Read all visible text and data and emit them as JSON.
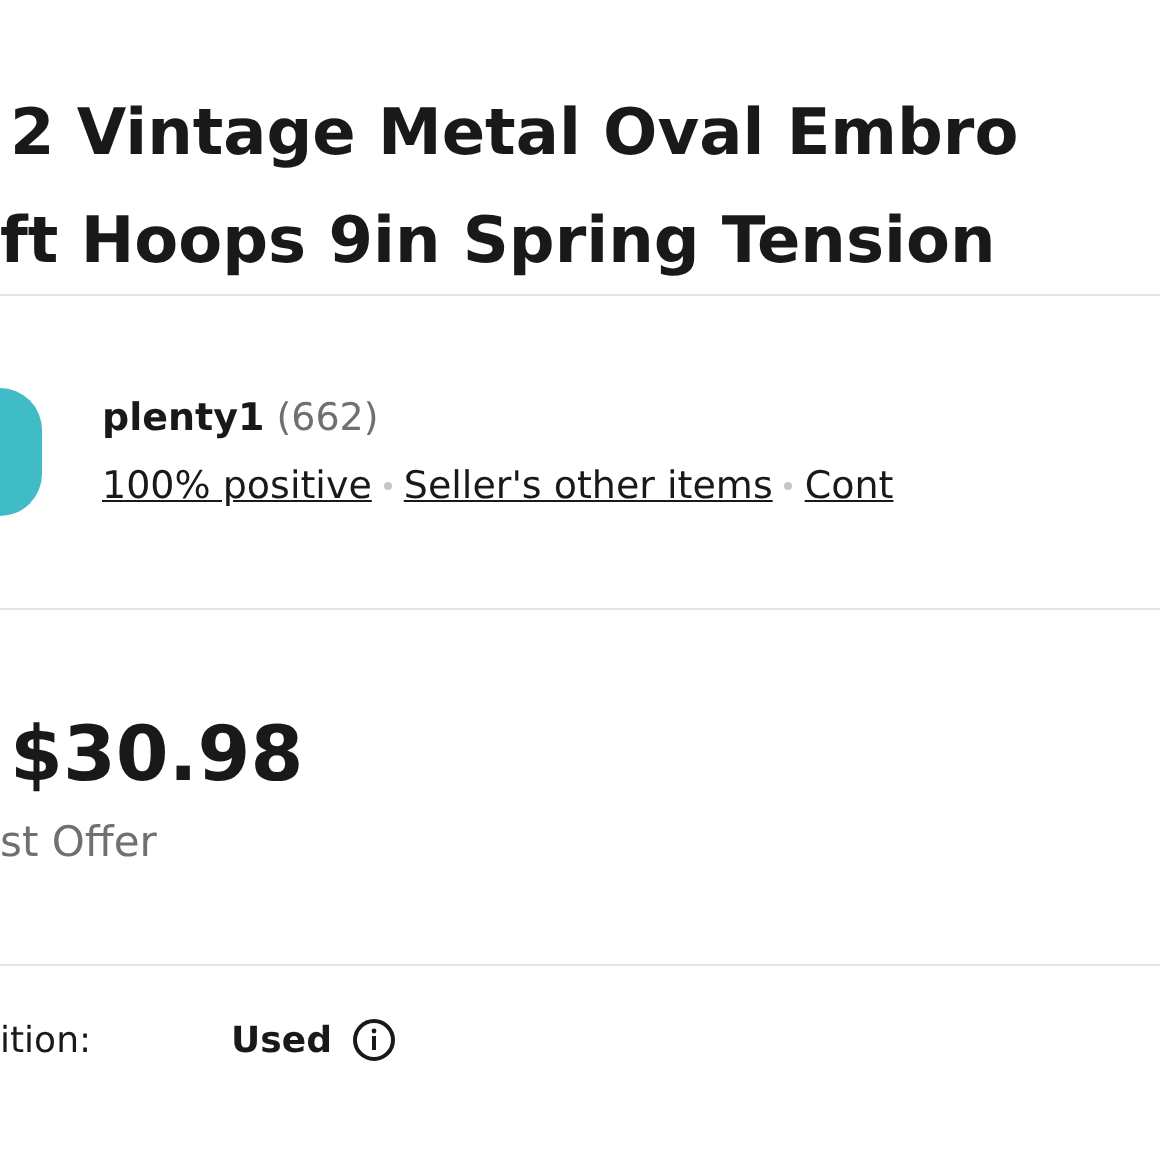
{
  "title_lines": [
    "2 Vintage Metal Oval Embro",
    "ft Hoops 9in Spring Tension"
  ],
  "seller": {
    "name": "plenty1",
    "feedback_count": "(662)",
    "links": [
      "100% positive",
      "Seller's other items",
      "Cont"
    ]
  },
  "price": {
    "amount": "$30.98",
    "offer_note": "st Offer"
  },
  "details": [
    {
      "label": "ition:",
      "value": "Used"
    }
  ]
}
